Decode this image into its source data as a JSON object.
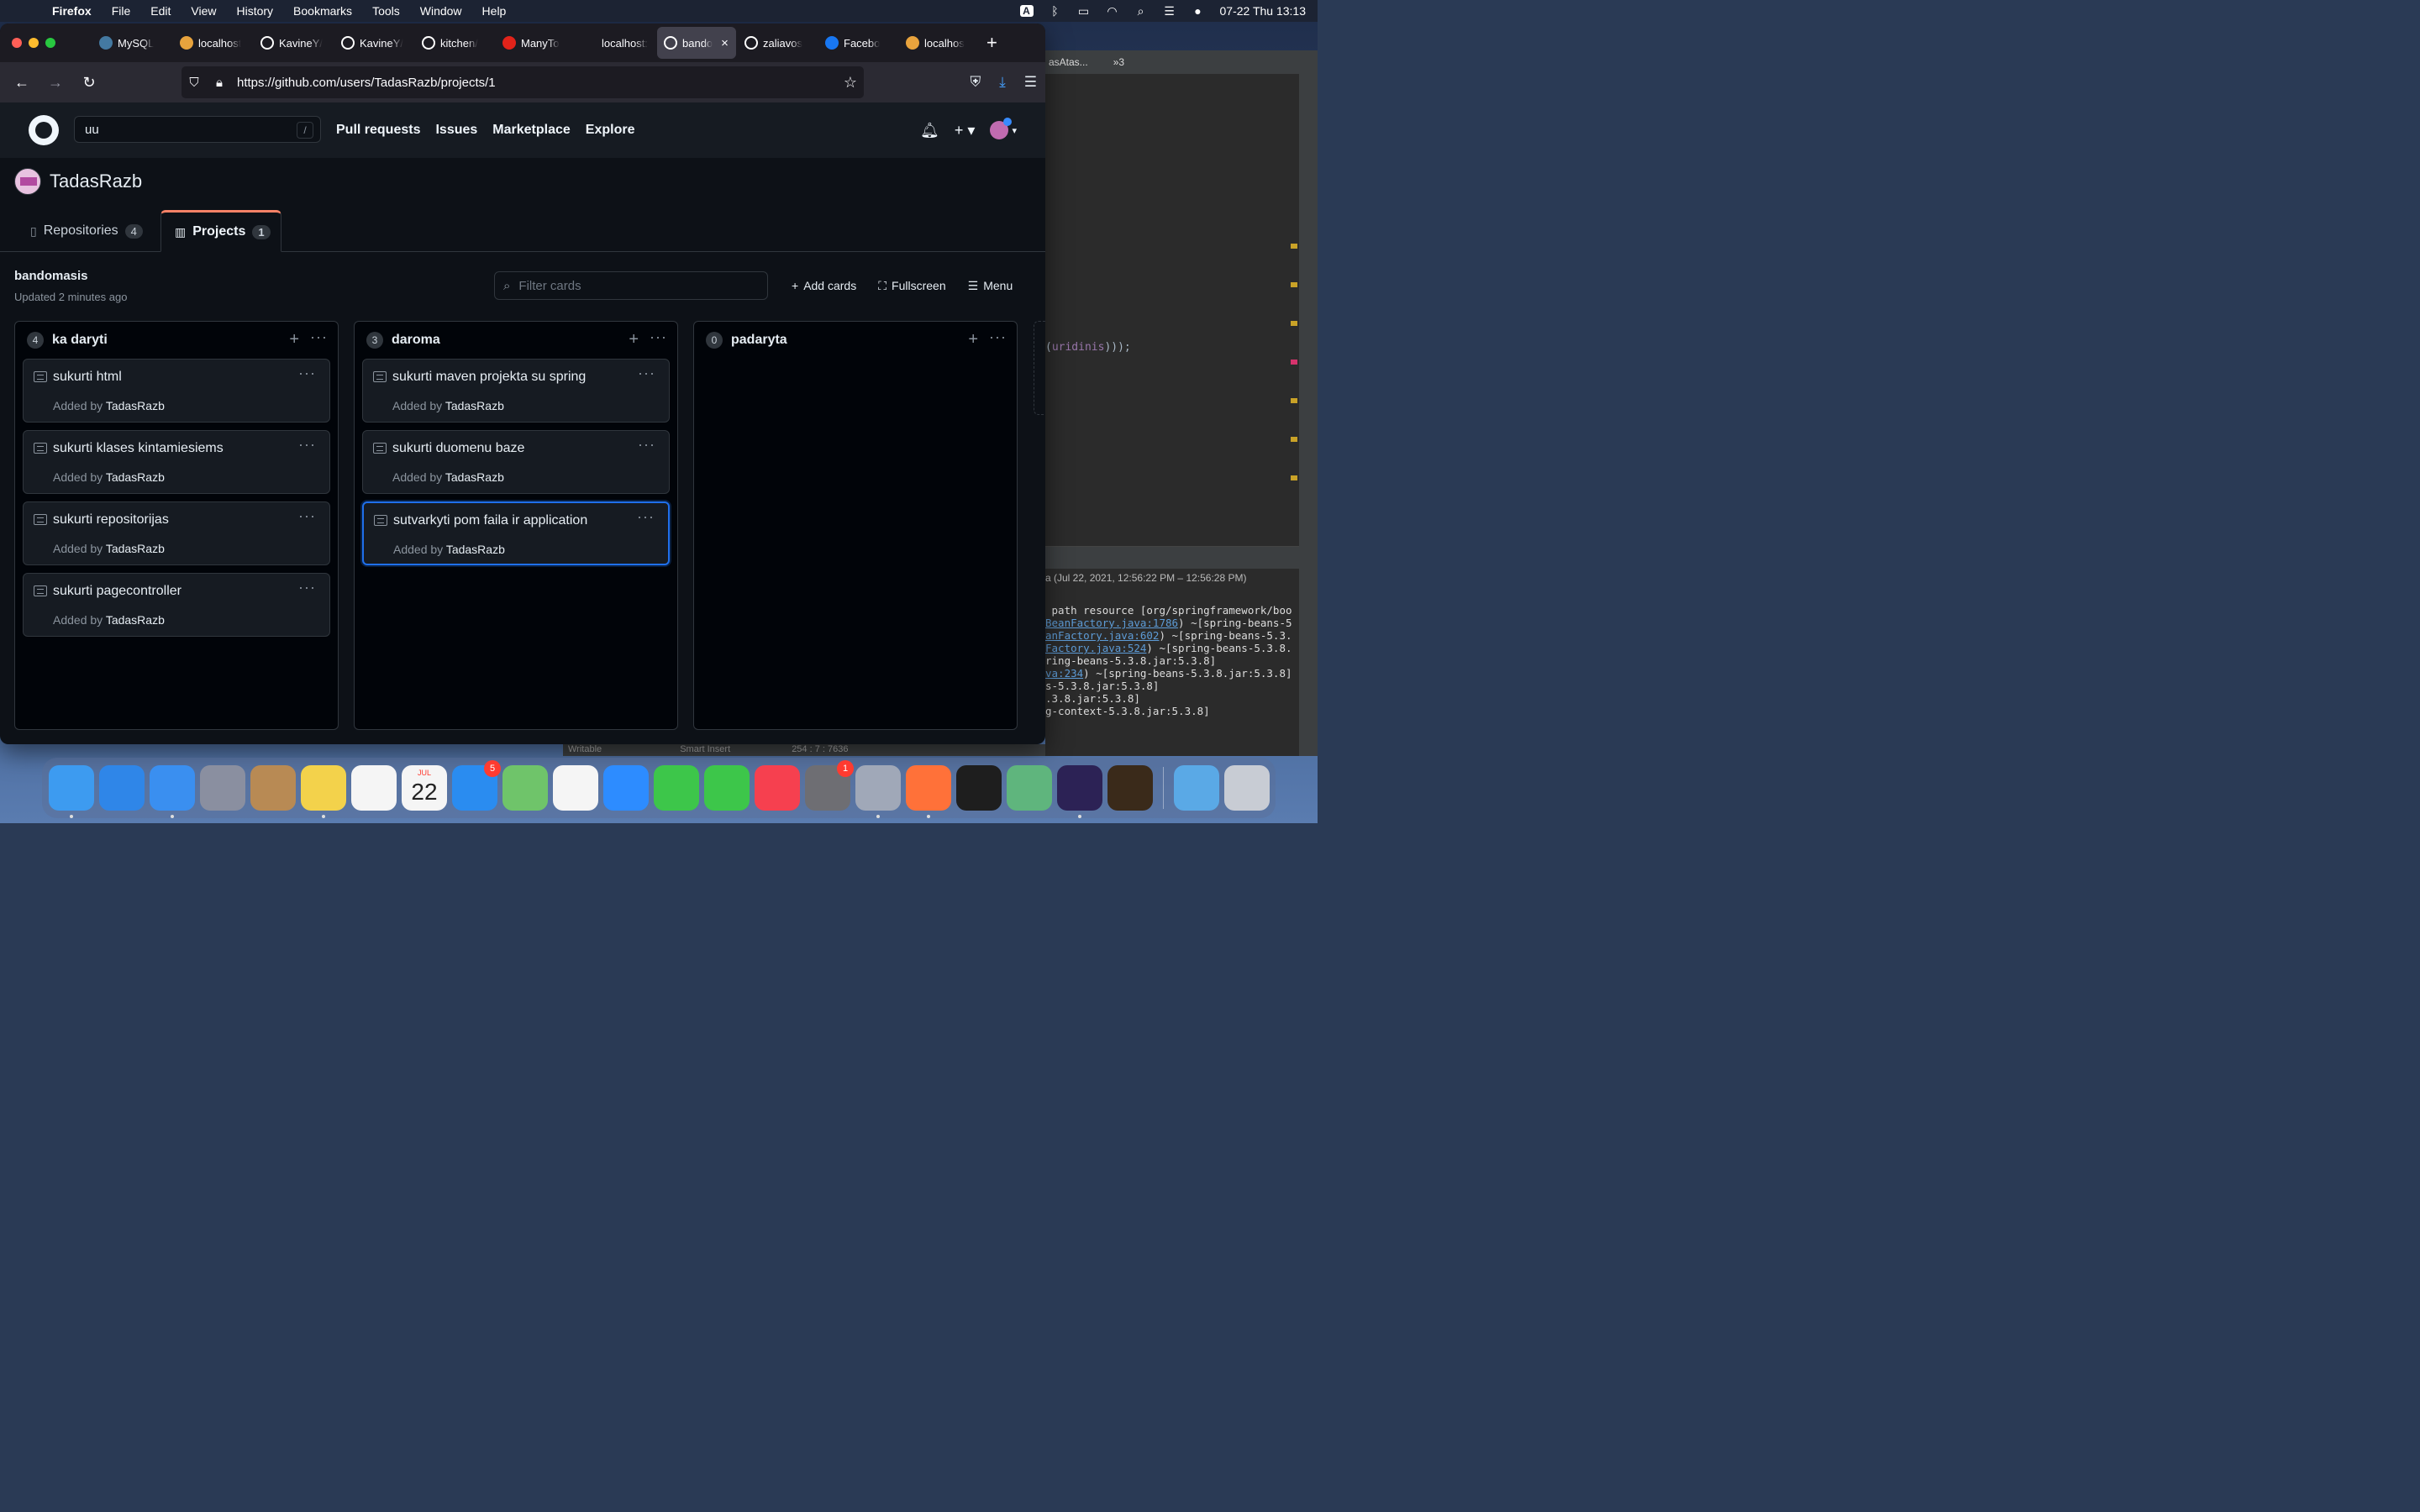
{
  "menubar": {
    "app": "Firefox",
    "items": [
      "File",
      "Edit",
      "View",
      "History",
      "Bookmarks",
      "Tools",
      "Window",
      "Help"
    ],
    "input_badge": "A",
    "datetime": "07-22 Thu  13:13"
  },
  "ide": {
    "tab_label": "asAtas...",
    "tab_more": "»3",
    "code_prefix": "(",
    "code_ident": "uridinis",
    "code_suffix": ")));",
    "console_stamp": "a  (Jul 22, 2021, 12:56:22 PM – 12:56:28 PM)",
    "log": [
      {
        "text": " path resource [org/springframework/boo",
        "link": ""
      },
      {
        "link": "BeanFactory.java:1786",
        "text": ") ~[spring-beans-5"
      },
      {
        "link": "anFactory.java:602",
        "text": ") ~[spring-beans-5.3."
      },
      {
        "link": "Factory.java:524",
        "text": ") ~[spring-beans-5.3.8."
      },
      {
        "text": "ring-beans-5.3.8.jar:5.3.8]",
        "link": ""
      },
      {
        "link": "va:234",
        "text": ") ~[spring-beans-5.3.8.jar:5.3.8]"
      },
      {
        "text": "s-5.3.8.jar:5.3.8]",
        "link": ""
      },
      {
        "text": ".3.8.jar:5.3.8]",
        "link": ""
      },
      {
        "text": "g-context-5.3.8.jar:5.3.8]",
        "link": ""
      }
    ],
    "status_left": "Writable",
    "status_mid": "Smart Insert",
    "status_right": "254 : 7 : 7636"
  },
  "browser": {
    "tabs": [
      {
        "label": "MySQL",
        "icon": "mysql-icon",
        "color": "#4479a1"
      },
      {
        "label": "localhost",
        "icon": "hawk-icon",
        "color": "#e8a33d"
      },
      {
        "label": "KavineY/",
        "icon": "github-icon",
        "color": "#ffffff"
      },
      {
        "label": "KavineY/",
        "icon": "github-icon",
        "color": "#ffffff"
      },
      {
        "label": "kitchen/",
        "icon": "github-icon",
        "color": "#ffffff"
      },
      {
        "label": "ManyTo",
        "icon": "oracle-icon",
        "color": "#e2231a"
      },
      {
        "label": "localhost:80",
        "icon": "",
        "color": ""
      },
      {
        "label": "bando",
        "icon": "github-icon",
        "color": "#ffffff",
        "active": true
      },
      {
        "label": "zaliavos",
        "icon": "github-icon",
        "color": "#ffffff"
      },
      {
        "label": "Facebo",
        "icon": "facebook-icon",
        "color": "#1877f2"
      },
      {
        "label": "localhos",
        "icon": "hawk-icon",
        "color": "#e8a33d"
      }
    ],
    "url": "https://github.com/users/TadasRazb/projects/1"
  },
  "github": {
    "search_value": "uu",
    "search_hotkey": "/",
    "nav": [
      "Pull requests",
      "Issues",
      "Marketplace",
      "Explore"
    ],
    "username": "TadasRazb",
    "tabs": [
      {
        "label": "Repositories",
        "count": "4"
      },
      {
        "label": "Projects",
        "count": "1"
      }
    ],
    "project": {
      "name": "bandomasis",
      "updated": "Updated 2 minutes ago",
      "filter_placeholder": "Filter cards",
      "add_cards": "Add cards",
      "fullscreen": "Fullscreen",
      "menu": "Menu"
    },
    "columns": [
      {
        "count": "4",
        "title": "ka daryti",
        "cards": [
          {
            "title": "sukurti html",
            "added_by": "Added by",
            "author": "TadasRazb"
          },
          {
            "title": "sukurti klases kintamiesiems",
            "added_by": "Added by",
            "author": "TadasRazb"
          },
          {
            "title": "sukurti repositorijas",
            "added_by": "Added by",
            "author": "TadasRazb"
          },
          {
            "title": "sukurti pagecontroller",
            "added_by": "Added by",
            "author": "TadasRazb"
          }
        ]
      },
      {
        "count": "3",
        "title": "daroma",
        "cards": [
          {
            "title": "sukurti maven projekta su spring",
            "added_by": "Added by",
            "author": "TadasRazb"
          },
          {
            "title": "sukurti duomenu baze",
            "added_by": "Added by",
            "author": "TadasRazb"
          },
          {
            "title": "sutvarkyti pom faila ir application",
            "added_by": "Added by",
            "author": "TadasRazb",
            "focused": true
          }
        ]
      },
      {
        "count": "0",
        "title": "padaryta",
        "cards": []
      }
    ]
  },
  "dock": {
    "apps": [
      {
        "name": "finder-icon",
        "color": "#3d9bf0",
        "running": true
      },
      {
        "name": "safari-icon",
        "color": "#2f86e8",
        "running": false
      },
      {
        "name": "mail-icon",
        "color": "#3a8ff0",
        "running": true
      },
      {
        "name": "launchpad-icon",
        "color": "#8a8fa0",
        "running": false
      },
      {
        "name": "contacts-icon",
        "color": "#b88a54",
        "running": false
      },
      {
        "name": "notes-icon",
        "color": "#f3d24b",
        "running": true
      },
      {
        "name": "reminders-icon",
        "color": "#f5f5f5",
        "running": false
      },
      {
        "name": "calendar-icon",
        "color": "#f5f5f5",
        "running": false,
        "month": "JUL",
        "day": "22"
      },
      {
        "name": "app-store-icon",
        "color": "#2a8cf0",
        "running": false,
        "badge": "5"
      },
      {
        "name": "maps-icon",
        "color": "#6fc46a",
        "running": false
      },
      {
        "name": "photos-icon",
        "color": "#f5f5f5",
        "running": false
      },
      {
        "name": "zoom-icon",
        "color": "#2d8cff",
        "running": false
      },
      {
        "name": "facetime-icon",
        "color": "#3dc64a",
        "running": false
      },
      {
        "name": "messages-icon",
        "color": "#3dc64a",
        "running": false
      },
      {
        "name": "music-icon",
        "color": "#f6404f",
        "running": false
      },
      {
        "name": "system-preferences-icon",
        "color": "#6e6e73",
        "running": false,
        "badge": "1"
      },
      {
        "name": "utility-icon",
        "color": "#a0a8b8",
        "running": true
      },
      {
        "name": "firefox-icon",
        "color": "#ff7139",
        "running": true
      },
      {
        "name": "terminal-icon",
        "color": "#1e1e1e",
        "running": false
      },
      {
        "name": "atom-icon",
        "color": "#5fb57d",
        "running": false
      },
      {
        "name": "eclipse-icon",
        "color": "#2c2255",
        "running": true
      },
      {
        "name": "rl-game-icon",
        "color": "#3a2a1a",
        "running": false
      },
      {
        "name": "downloads-folder-icon",
        "color": "#5aa9e6",
        "running": false
      },
      {
        "name": "trash-icon",
        "color": "#c8ccd4",
        "running": false
      }
    ]
  }
}
